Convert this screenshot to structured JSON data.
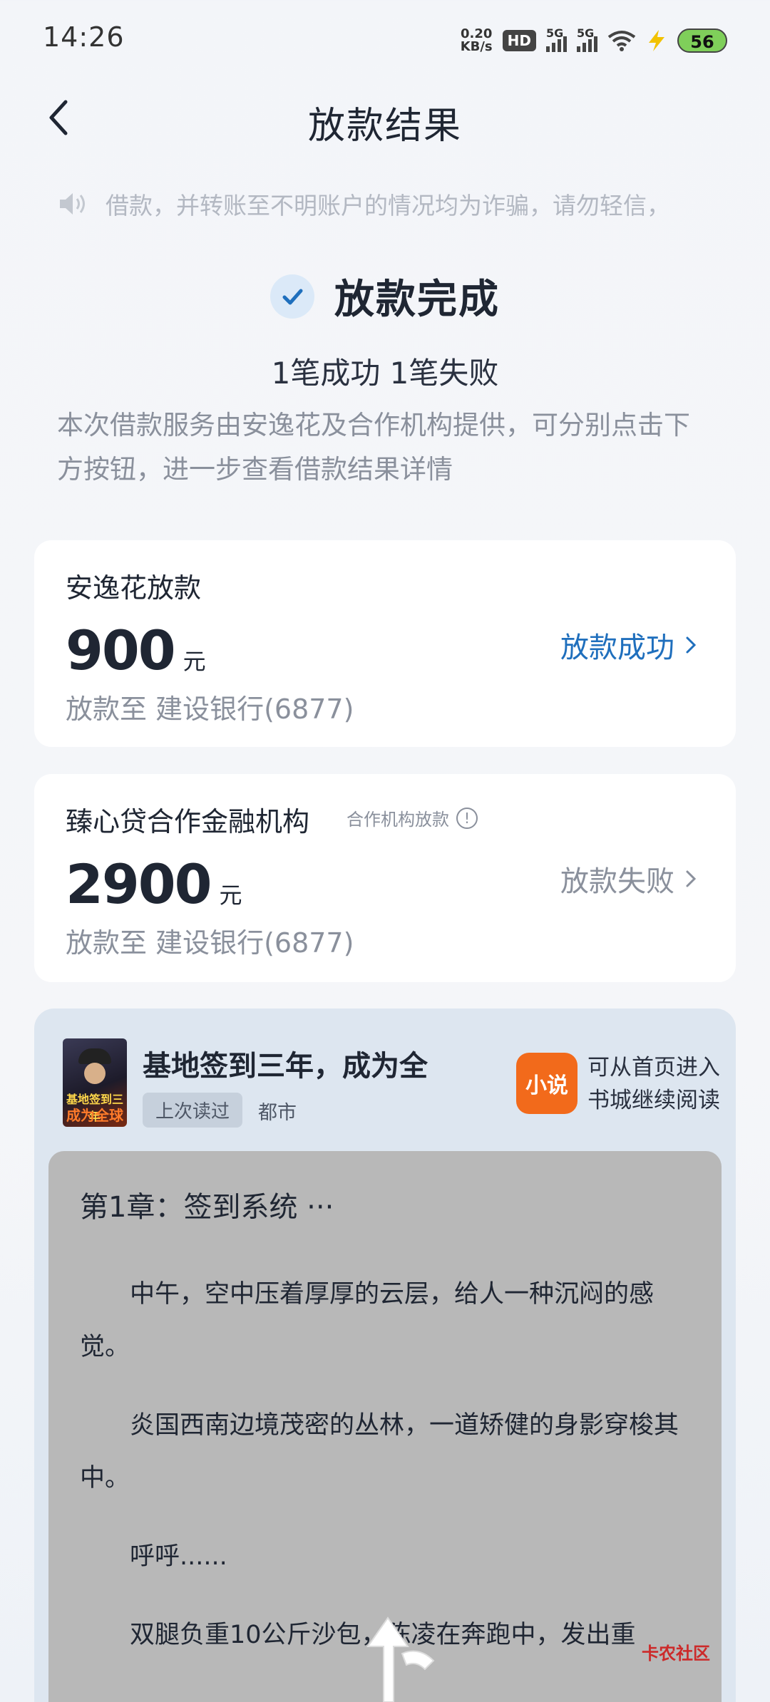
{
  "status_bar": {
    "time": "14:26",
    "net_speed_value": "0.20",
    "net_speed_unit": "KB/s",
    "hd_label": "HD",
    "sim1_label": "5G",
    "sim2_label": "5G",
    "battery": "56"
  },
  "nav": {
    "title": "放款结果"
  },
  "notice": {
    "text": "借款，并转账至不明账户的情况均为诈骗，请勿轻信，"
  },
  "result": {
    "title": "放款完成",
    "summary": "1笔成功 1笔失败",
    "description": "本次借款服务由安逸花及合作机构提供，可分别点击下方按钮，进一步查看借款结果详情"
  },
  "loans": [
    {
      "name": "安逸花放款",
      "amount": "900",
      "unit": "元",
      "destination": "放款至 建设银行(6877)",
      "status": "放款成功"
    },
    {
      "name": "臻心贷合作金融机构",
      "tag": "合作机构放款",
      "amount": "2900",
      "unit": "元",
      "destination": "放款至 建设银行(6877)",
      "status": "放款失败"
    }
  ],
  "book_ad": {
    "title": "基地签到三年，成为全",
    "last_read_badge": "上次读过",
    "genre": "都市",
    "cover_small_text": "基地签到三年",
    "cover_big_text": "成为全球",
    "app_name": "小说",
    "app_tip_line1": "可从首页进入",
    "app_tip_line2": "书城继续阅读",
    "chapter_title": "第1章：签到系统 ···",
    "paragraphs": [
      "中午，空中压着厚厚的云层，给人一种沉闷的感觉。",
      "炎国西南边境茂密的丛林，一道矫健的身影穿梭其中。",
      "呼呼......",
      "双腿负重10公斤沙包，陈凌在奔跑中，发出重"
    ]
  },
  "watermark": {
    "text": "卡农社区"
  },
  "colors": {
    "accent_blue": "#1f6fbd",
    "success_bg": "#dbe9f8",
    "muted_gray": "#8a909c",
    "app_orange": "#f26a1b"
  }
}
